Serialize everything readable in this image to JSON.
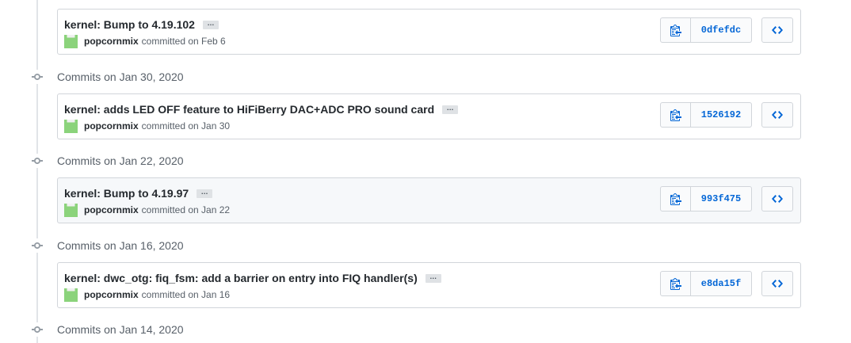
{
  "groups": [
    {
      "title": "Commits on Jan 30, 2020"
    },
    {
      "title": "Commits on Jan 22, 2020"
    },
    {
      "title": "Commits on Jan 16, 2020"
    },
    {
      "title": "Commits on Jan 14, 2020"
    }
  ],
  "commits": [
    {
      "title": "kernel: Bump to 4.19.102",
      "ellipsis": "…",
      "author": "popcornmix",
      "committed_text": "committed on Feb 6",
      "sha": "0dfefdc"
    },
    {
      "title": "kernel: adds LED OFF feature to HiFiBerry DAC+ADC PRO sound card",
      "ellipsis": "…",
      "author": "popcornmix",
      "committed_text": "committed on Jan 30",
      "sha": "1526192"
    },
    {
      "title": "kernel: Bump to 4.19.97",
      "ellipsis": "…",
      "author": "popcornmix",
      "committed_text": "committed on Jan 22",
      "sha": "993f475"
    },
    {
      "title": "kernel: dwc_otg: fiq_fsm: add a barrier on entry into FIQ handler(s)",
      "ellipsis": "…",
      "author": "popcornmix",
      "committed_text": "committed on Jan 16",
      "sha": "e8da15f"
    }
  ],
  "icons": {
    "commit_dot": "git-commit-icon",
    "copy": "clipboard-icon",
    "browse": "code-icon",
    "avatar": "identicon-avatar"
  },
  "colors": {
    "link": "#0366d6",
    "avatar_green": "#8bd37b",
    "border": "#d1d5da",
    "muted_text": "#586069"
  }
}
